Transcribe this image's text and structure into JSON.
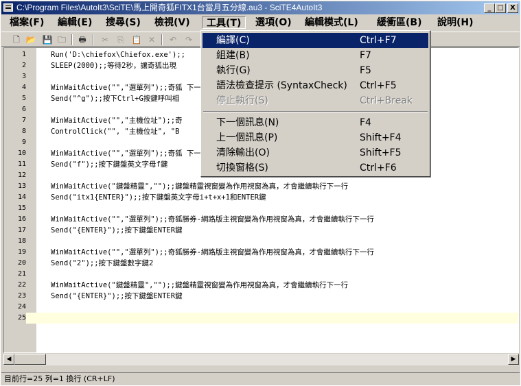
{
  "window": {
    "title": "C:\\Program Files\\AutoIt3\\SciTE\\馬上開奇狐FITX1台當月五分線.au3 - SciTE4AutoIt3",
    "min_label": "_",
    "max_label": "□",
    "close_label": "X"
  },
  "menu": [
    {
      "label": "檔案(F)"
    },
    {
      "label": "編輯(E)"
    },
    {
      "label": "搜尋(S)"
    },
    {
      "label": "檢視(V)"
    },
    {
      "label": "工具(T)"
    },
    {
      "label": "選項(O)"
    },
    {
      "label": "編輯模式(L)"
    },
    {
      "label": "緩衝區(B)"
    },
    {
      "label": "說明(H)"
    }
  ],
  "toolbar": {
    "icons": [
      "new-file-icon",
      "open-folder-icon",
      "save-icon",
      "close-file-icon",
      "print-icon",
      "cut-icon",
      "copy-icon",
      "paste-icon",
      "delete-icon",
      "undo-icon",
      "redo-icon"
    ],
    "glyphs": [
      "🗋",
      "📂",
      "💾",
      "🗀",
      "🖶",
      "✂",
      "⎘",
      "📋",
      "✕",
      "↶",
      "↷"
    ]
  },
  "tools_menu": [
    {
      "label": "編譯(C)",
      "shortcut": "Ctrl+F7",
      "state": "selected"
    },
    {
      "label": "組建(B)",
      "shortcut": "F7",
      "state": "normal"
    },
    {
      "label": "執行(G)",
      "shortcut": "F5",
      "state": "normal"
    },
    {
      "label": "語法檢查提示 (SyntaxCheck)",
      "shortcut": "Ctrl+F5",
      "state": "normal"
    },
    {
      "label": "停止執行(S)",
      "shortcut": "Ctrl+Break",
      "state": "disabled"
    },
    {
      "label": "下一個訊息(N)",
      "shortcut": "F4",
      "state": "normal"
    },
    {
      "label": "上一個訊息(P)",
      "shortcut": "Shift+F4",
      "state": "normal"
    },
    {
      "label": "清除輸出(O)",
      "shortcut": "Shift+F5",
      "state": "normal"
    },
    {
      "label": "切換窗格(S)",
      "shortcut": "Ctrl+F6",
      "state": "normal"
    }
  ],
  "editor": {
    "lines": [
      {
        "n": "1",
        "code": "Run('D:\\chiefox\\Chiefox.exe');;"
      },
      {
        "n": "2",
        "code": "SLEEP(2000);;等待2秒，讓奇狐出現"
      },
      {
        "n": "3",
        "code": ""
      },
      {
        "n": "4",
        "code": "WinWaitActive(\"\",\"選單列\");;奇狐                                                  下一行"
      },
      {
        "n": "5",
        "code": "Send(\"^g\");;按下Ctrl+G按鍵呼叫相"
      },
      {
        "n": "6",
        "code": ""
      },
      {
        "n": "7",
        "code": "WinWaitActive(\"\",\"主機位址\");;奇"
      },
      {
        "n": "8",
        "code": "ControlClick(\"\", \"主機位址\", \"B"
      },
      {
        "n": "9",
        "code": ""
      },
      {
        "n": "10",
        "code": "WinWaitActive(\"\",\"選單列\");;奇狐                                                  下一行"
      },
      {
        "n": "11",
        "code": "Send(\"f\");;按下鍵盤英文字母f鍵"
      },
      {
        "n": "12",
        "code": ""
      },
      {
        "n": "13",
        "code": "WinWaitActive(\"鍵盤精靈\",\"\");;鍵盤精靈視窗變為作用視窗為真，才會繼續執行下一行"
      },
      {
        "n": "14",
        "code": "Send(\"itx1{ENTER}\");;按下鍵盤英文字母i+t+x+1和ENTER鍵"
      },
      {
        "n": "15",
        "code": ""
      },
      {
        "n": "16",
        "code": "WinWaitActive(\"\",\"選單列\");;奇狐勝券-網路版主視窗變為作用視窗為真，才會繼續執行下一行"
      },
      {
        "n": "17",
        "code": "Send(\"{ENTER}\");;按下鍵盤ENTER鍵"
      },
      {
        "n": "18",
        "code": ""
      },
      {
        "n": "19",
        "code": "WinWaitActive(\"\",\"選單列\");;奇狐勝券-網路版主視窗變為作用視窗為真，才會繼續執行下一行"
      },
      {
        "n": "20",
        "code": "Send(\"2\");;按下鍵盤數字鍵2"
      },
      {
        "n": "21",
        "code": ""
      },
      {
        "n": "22",
        "code": "WinWaitActive(\"鍵盤精靈\",\"\");;鍵盤精靈視窗變為作用視窗為真，才會繼續執行下一行"
      },
      {
        "n": "23",
        "code": "Send(\"{ENTER}\");;按下鍵盤ENTER鍵"
      },
      {
        "n": "24",
        "code": ""
      },
      {
        "n": "25",
        "code": ""
      }
    ],
    "caret_line": "25"
  },
  "scrollbar": {
    "left_arrow": "◀",
    "right_arrow": "▶"
  },
  "status": {
    "text": "目前行=25 列=1 換行 (CR+LF)"
  }
}
